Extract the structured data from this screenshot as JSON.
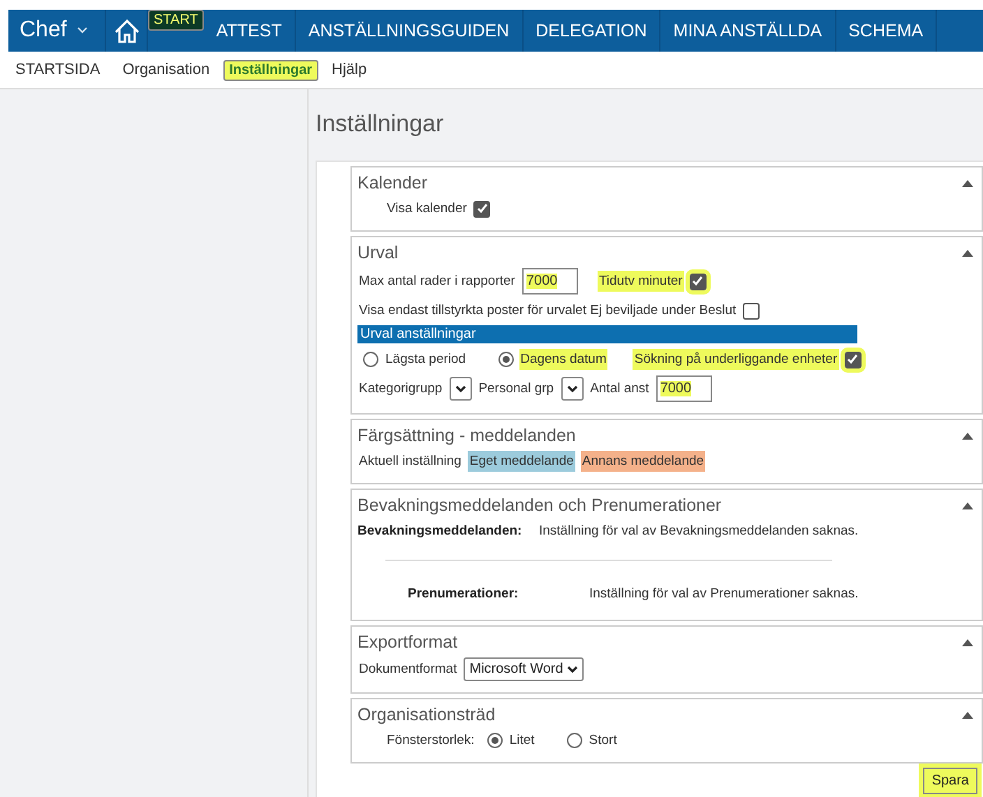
{
  "nav": {
    "menu_label": "Chef",
    "items": [
      {
        "label": "START",
        "selected": true,
        "highlighted": true
      },
      {
        "label": "ATTEST",
        "selected": false,
        "highlighted": false
      },
      {
        "label": "ANSTÄLLNINGSGUIDEN",
        "selected": false,
        "highlighted": false
      },
      {
        "label": "DELEGATION",
        "selected": false,
        "highlighted": false
      },
      {
        "label": "MINA ANSTÄLLDA",
        "selected": false,
        "highlighted": false
      },
      {
        "label": "SCHEMA",
        "selected": false,
        "highlighted": false
      }
    ]
  },
  "subnav": [
    {
      "label": "STARTSIDA",
      "selected": false,
      "highlighted": false
    },
    {
      "label": "Organisation",
      "selected": false,
      "highlighted": false
    },
    {
      "label": "Inställningar",
      "selected": true,
      "highlighted": true
    },
    {
      "label": "Hjälp",
      "selected": false,
      "highlighted": false
    }
  ],
  "page_title": "Inställningar",
  "sections": [
    {
      "title": "Kalender",
      "expanded": true,
      "kind": "form",
      "rows": [
        [
          {
            "kind": "indented_checkbox",
            "label": "Visa kalender",
            "checked": true,
            "highlighted": false
          }
        ]
      ]
    },
    {
      "title": "Urval",
      "expanded": true,
      "kind": "form",
      "rows": [
        [
          {
            "kind": "input",
            "label": "Max antal rader i rapporter",
            "value": "7000",
            "highlighted": true
          },
          {
            "kind": "checkbox",
            "label": "Tidutv minuter",
            "checked": true,
            "highlighted": true
          }
        ],
        [
          {
            "kind": "checkbox",
            "label": "Visa endast tillstyrkta poster för urvalet Ej beviljade under Beslut",
            "checked": false,
            "highlighted": false
          }
        ],
        [
          {
            "kind": "band",
            "label": "Urval anställningar"
          }
        ],
        [
          {
            "kind": "radio",
            "label": "Lägsta period",
            "selected": false,
            "highlighted": false
          },
          {
            "kind": "radio",
            "label": "Dagens datum",
            "selected": true,
            "highlighted": true
          },
          {
            "kind": "checkbox",
            "label": "Sökning på underliggande enheter",
            "checked": true,
            "highlighted": true
          }
        ],
        [
          {
            "kind": "select",
            "label": "Kategorigrupp"
          },
          {
            "kind": "select",
            "label": "Personal grp"
          },
          {
            "kind": "input",
            "label": "Antal anst",
            "value": "7000",
            "highlighted": true
          }
        ]
      ]
    },
    {
      "title": "Färgsättning - meddelanden",
      "expanded": true,
      "kind": "form",
      "rows": [
        [
          {
            "kind": "text",
            "label": "Aktuell inställning"
          },
          {
            "kind": "swatch",
            "label": "Eget meddelande",
            "color": "#9ccbdc"
          },
          {
            "kind": "swatch",
            "label": "Annans meddelande",
            "color": "#f4b18a"
          }
        ]
      ]
    },
    {
      "title": "Bevakningsmeddelanden och Prenumerationer",
      "expanded": true,
      "kind": "info",
      "entries": [
        {
          "label": "Bevakningsmeddelanden:",
          "text": "Inställning för val av Bevakningsmeddelanden saknas."
        },
        {
          "label": "Prenumerationer:",
          "text": "Inställning för val av Prenumerationer saknas."
        }
      ]
    },
    {
      "title": "Exportformat",
      "expanded": true,
      "kind": "form",
      "rows": [
        [
          {
            "kind": "select",
            "label": "Dokumentformat",
            "value": "Microsoft Word"
          }
        ]
      ]
    },
    {
      "title": "Organisationsträd",
      "expanded": true,
      "kind": "form",
      "rows": [
        [
          {
            "kind": "indented_text",
            "label": "Fönsterstorlek:"
          },
          {
            "kind": "radio",
            "label": "Litet",
            "selected": true,
            "highlighted": false
          },
          {
            "kind": "radio",
            "label": "Stort",
            "selected": false,
            "highlighted": false
          }
        ]
      ]
    }
  ],
  "save_button": {
    "label": "Spara",
    "highlighted": true
  }
}
